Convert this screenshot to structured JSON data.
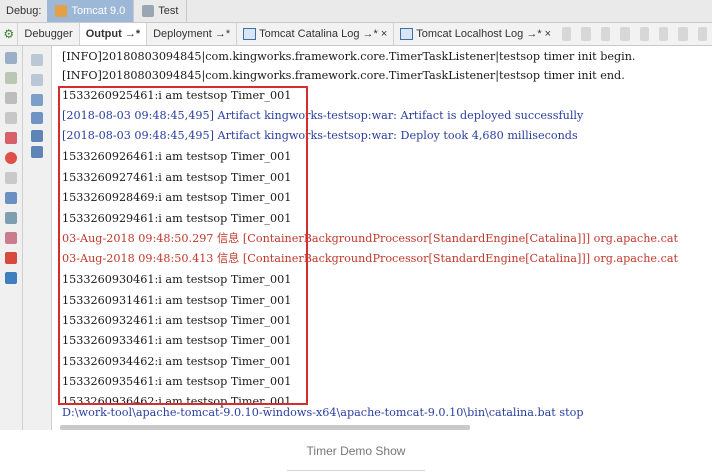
{
  "topbar": {
    "label": "Debug:",
    "tabs": [
      {
        "label": "Tomcat 9.0",
        "icon": "tomcat-icon",
        "active": true
      },
      {
        "label": "Test",
        "icon": "test-icon",
        "active": false
      }
    ]
  },
  "subbar": {
    "tabs": [
      {
        "label": "Debugger"
      },
      {
        "label": "Output →*"
      },
      {
        "label": "Deployment →*"
      },
      {
        "label": "Tomcat Catalina Log →* ×"
      },
      {
        "label": "Tomcat Localhost Log →* ×"
      }
    ]
  },
  "console": {
    "lines": [
      {
        "text": "[INFO]20180803094845|com.kingworks.framework.core.TimerTaskListener|testsop timer init begin.",
        "color": "black"
      },
      {
        "text": "[INFO]20180803094845|com.kingworks.framework.core.TimerTaskListener|testsop timer init end.",
        "color": "black"
      },
      {
        "text": "1533260925461:i am testsop Timer_001",
        "color": "black"
      },
      {
        "text": "[2018-08-03 09:48:45,495] Artifact kingworks-testsop:war: Artifact is deployed successfully",
        "color": "blue"
      },
      {
        "text": "[2018-08-03 09:48:45,495] Artifact kingworks-testsop:war: Deploy took 4,680 milliseconds",
        "color": "blue"
      },
      {
        "text": "1533260926461:i am testsop Timer_001",
        "color": "black"
      },
      {
        "text": "1533260927461:i am testsop Timer_001",
        "color": "black"
      },
      {
        "text": "1533260928469:i am testsop Timer_001",
        "color": "black"
      },
      {
        "text": "1533260929461:i am testsop Timer_001",
        "color": "black"
      },
      {
        "text": "03-Aug-2018 09:48:50.297 信息 [ContainerBackgroundProcessor[StandardEngine[Catalina]]] org.apache.cat",
        "color": "red"
      },
      {
        "text": "03-Aug-2018 09:48:50.413 信息 [ContainerBackgroundProcessor[StandardEngine[Catalina]]] org.apache.cat",
        "color": "red"
      },
      {
        "text": "1533260930461:i am testsop Timer_001",
        "color": "black"
      },
      {
        "text": "1533260931461:i am testsop Timer_001",
        "color": "black"
      },
      {
        "text": "1533260932461:i am testsop Timer_001",
        "color": "black"
      },
      {
        "text": "1533260933461:i am testsop Timer_001",
        "color": "black"
      },
      {
        "text": "1533260934462:i am testsop Timer_001",
        "color": "black"
      },
      {
        "text": "1533260935461:i am testsop Timer_001",
        "color": "black"
      },
      {
        "text": "1533260936462:i am testsop Timer_001",
        "color": "black"
      },
      {
        "text": "D:\\work-tool\\apache-tomcat-9.0.10-windows-x64\\apache-tomcat-9.0.10\\bin\\catalina.bat stop",
        "color": "blue"
      }
    ]
  },
  "caption": "Timer Demo Show",
  "colors": {
    "highlight": "#d62e2e",
    "log_black": "#1a1a1a",
    "log_blue": "#2a3f9e",
    "log_red": "#c0392b"
  }
}
